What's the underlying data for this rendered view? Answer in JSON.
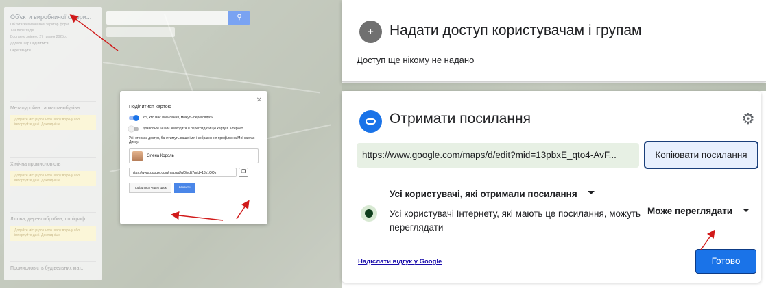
{
  "map_sidebar": {
    "title": "Об'єкти виробничої сфери...",
    "subtitle": "Об'єкти за виконавчої територ формі",
    "views": "129 переглядів",
    "edited": "Востаннє змінено 27 травня 2025р.",
    "actions": "Додати шар   Поділитися",
    "preview": "Переглянути",
    "layers": [
      {
        "title": "Металургійна та машинобудівн...",
        "note": "Додайте місця до цього шару вручну або імпортуйте дані. Докладніше"
      },
      {
        "title": "Хімічна промисловість",
        "note": "Додайте місця до цього шару вручну або імпортуйте дані. Докладніше"
      },
      {
        "title": "Лісова, деревообробна, поліграф...",
        "note": "Додайте місця до цього шару вручну або імпортуйте дані. Докладніше"
      },
      {
        "title": "Промисловість будівельних мат..."
      }
    ]
  },
  "share_map_dialog": {
    "title": "Поділитися картою",
    "toggle1": "Усі, хто має посилання, можуть переглядати",
    "toggle2": "Дозвольте іншим знаходити й переглядати цю карту в Інтернеті",
    "info": "Усі, хто має доступ, бачитимуть ваше ім'я і зображення профілю на Мої картах і Диску.",
    "person": "Олена Король",
    "link": "https://www.google.com/maps/d/u/0/edit?mid=13x1QOs",
    "share_drive_button": "Поділитися через Диск",
    "close_button": "Закрити"
  },
  "share_users": {
    "title": "Надати доступ користувачам і групам",
    "status": "Доступ ще нікому не надано"
  },
  "get_link": {
    "title": "Отримати посилання",
    "url": "https://www.google.com/maps/d/edit?mid=13pbxE_qto4-AvF...",
    "copy_button": "Копіювати посилання",
    "audience": "Усі користувачі, які отримали посилання",
    "audience_desc": "Усі користувачі Інтернету, які мають це посилання, можуть переглядати",
    "permission": "Може переглядати",
    "feedback_link": "Надіслати відгук у Google",
    "done_button": "Готово"
  },
  "colors": {
    "accent": "#1a73e8",
    "link_field_bg": "#e7f0e4",
    "arrow": "#d11a1a"
  },
  "icons": [
    "person-add-icon",
    "link-icon",
    "gear-icon",
    "globe-icon",
    "copy-icon",
    "search-icon"
  ]
}
